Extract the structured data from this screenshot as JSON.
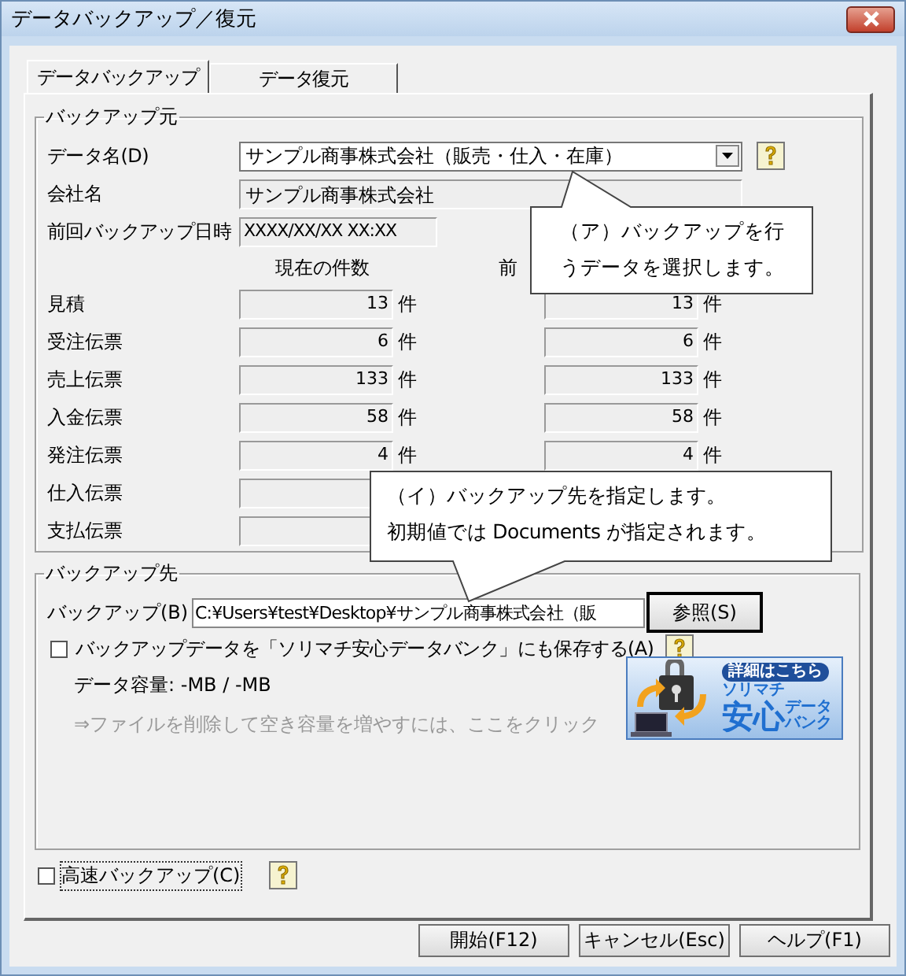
{
  "window": {
    "title": "データバックアップ／復元"
  },
  "tabs": [
    {
      "label": "データバックアップ",
      "selected": true
    },
    {
      "label": "データ復元",
      "selected": false
    }
  ],
  "source": {
    "title": "バックアップ元",
    "data_name": {
      "label": "データ名(D)",
      "value": "サンプル商事株式会社（販売・仕入・在庫）"
    },
    "company": {
      "label": "会社名",
      "value": "サンプル商事株式会社"
    },
    "last_backup": {
      "label": "前回バックアップ日時",
      "value": "XXXX/XX/XX XX:XX"
    },
    "columns": [
      "現在の件数",
      "前"
    ],
    "rows": [
      {
        "label": "見積",
        "current": {
          "value": "13",
          "unit": "件"
        },
        "previous": {
          "value": "13",
          "unit": "件"
        }
      },
      {
        "label": "受注伝票",
        "current": {
          "value": "6",
          "unit": "件"
        },
        "previous": {
          "value": "6",
          "unit": "件"
        }
      },
      {
        "label": "売上伝票",
        "current": {
          "value": "133",
          "unit": "件"
        },
        "previous": {
          "value": "133",
          "unit": "件"
        }
      },
      {
        "label": "入金伝票",
        "current": {
          "value": "58",
          "unit": "件"
        },
        "previous": {
          "value": "58",
          "unit": "件"
        }
      },
      {
        "label": "発注伝票",
        "current": {
          "value": "4",
          "unit": "件"
        },
        "previous": {
          "value": "4",
          "unit": "件"
        }
      },
      {
        "label": "仕入伝票"
      },
      {
        "label": "支払伝票"
      }
    ]
  },
  "destination": {
    "title": "バックアップ先",
    "path": {
      "label": "バックアップ(B)",
      "value": "C:¥Users¥test¥Desktop¥サンプル商事株式会社（販"
    },
    "browse_button": "参照(S)",
    "databank_option": {
      "label": "バックアップデータを「ソリマチ安心データバンク」にも保存する(A)",
      "checked": false
    },
    "capacity": "データ容量: -MB / -MB",
    "cleanup_link": "⇒ファイルを削除して空き容量を増やすには、ここをクリック",
    "banner": {
      "badge": "詳細はこちら",
      "brand": "ソリマチ",
      "title": "安心",
      "sub1": "データ",
      "sub2": "バンク"
    }
  },
  "fast_backup": {
    "label": "高速バックアップ(C)",
    "checked": false
  },
  "buttons": [
    "開始(F12)",
    "キャンセル(Esc)",
    "ヘルプ(F1)"
  ],
  "callouts": [
    {
      "lines": [
        "（ア）バックアップを行",
        "うデータを選択します。"
      ]
    },
    {
      "lines": [
        "（イ）バックアップ先を指定します。",
        "初期値では Documents が指定されます。"
      ]
    }
  ]
}
